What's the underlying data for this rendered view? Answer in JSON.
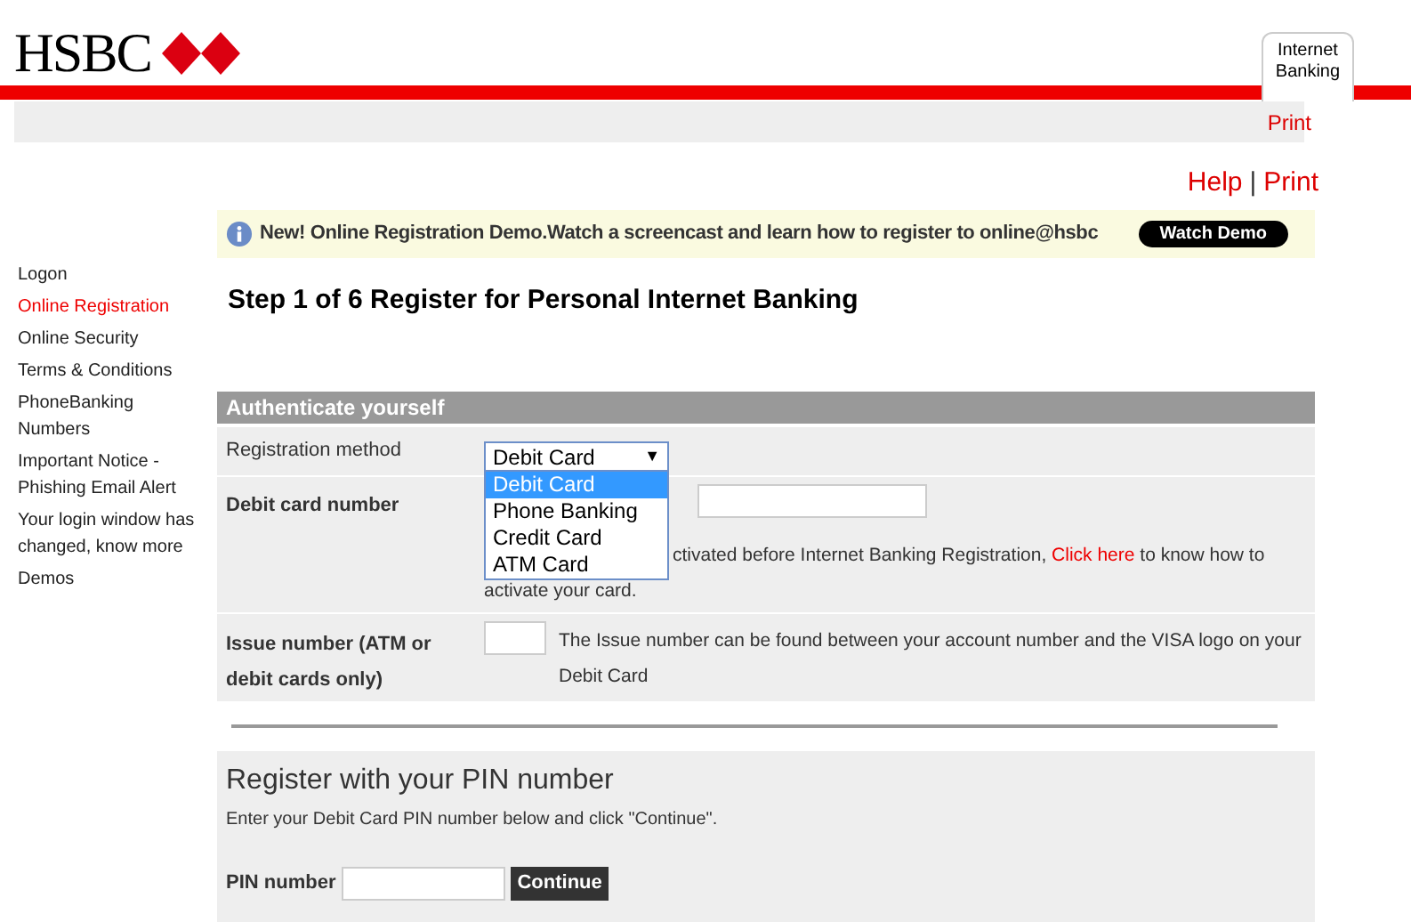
{
  "header": {
    "logo": "HSBC",
    "tab": "Internet Banking",
    "print": "Print"
  },
  "links": [
    {
      "label": "Help"
    },
    {
      "label": "|"
    },
    {
      "label": "Print"
    }
  ],
  "notice": {
    "text": "New! Online Registration Demo.Watch a screencast and learn how to register to online@hsbc",
    "button": "Watch Demo"
  },
  "sidebar": {
    "items": [
      {
        "label": "Logon",
        "selected": false
      },
      {
        "label": "Online Registration",
        "selected": true
      },
      {
        "label": "Online Security",
        "selected": false
      },
      {
        "label": "Terms & Conditions",
        "selected": false
      },
      {
        "label": "PhoneBanking Numbers",
        "selected": false
      },
      {
        "label": "Important Notice - Phishing Email Alert",
        "selected": false
      },
      {
        "label": "Your login window has changed, know more",
        "selected": false
      },
      {
        "label": "Demos",
        "selected": false
      }
    ]
  },
  "title": "Step 1 of 6 Register for Personal Internet Banking",
  "form": {
    "heading": "Authenticate yourself",
    "method_label": "Registration method",
    "method_value": "Debit Card",
    "caret": "▼",
    "options": [
      {
        "label": "Debit Card",
        "selected": true
      },
      {
        "label": "Phone Banking",
        "selected": false
      },
      {
        "label": "Credit Card",
        "selected": false
      },
      {
        "label": "ATM Card",
        "selected": false
      }
    ],
    "card_label": "Debit card number",
    "card_note_before": "ctivated before Internet Banking Registration,",
    "card_note_link": "Click here",
    "card_note_after": "to know how to activate your card.",
    "issue_label": "Issue number (ATM or debit cards only)",
    "issue_note": "The Issue number can be found between your account number and the VISA logo on your Debit Card"
  },
  "pin": {
    "title": "Register with your PIN number",
    "text": "Enter your Debit Card PIN number below and click \"Continue\".",
    "label": "PIN number",
    "button": "Continue"
  }
}
